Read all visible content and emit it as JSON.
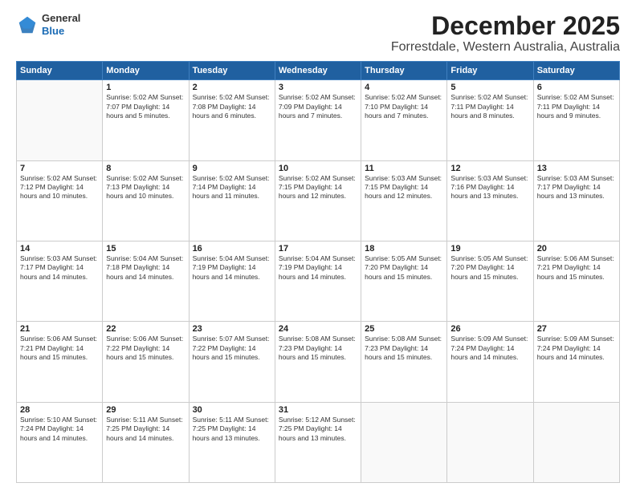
{
  "header": {
    "logo_general": "General",
    "logo_blue": "Blue",
    "title": "December 2025",
    "subtitle": "Forrestdale, Western Australia, Australia"
  },
  "calendar": {
    "days_of_week": [
      "Sunday",
      "Monday",
      "Tuesday",
      "Wednesday",
      "Thursday",
      "Friday",
      "Saturday"
    ],
    "weeks": [
      [
        {
          "day": "",
          "info": ""
        },
        {
          "day": "1",
          "info": "Sunrise: 5:02 AM\nSunset: 7:07 PM\nDaylight: 14 hours\nand 5 minutes."
        },
        {
          "day": "2",
          "info": "Sunrise: 5:02 AM\nSunset: 7:08 PM\nDaylight: 14 hours\nand 6 minutes."
        },
        {
          "day": "3",
          "info": "Sunrise: 5:02 AM\nSunset: 7:09 PM\nDaylight: 14 hours\nand 7 minutes."
        },
        {
          "day": "4",
          "info": "Sunrise: 5:02 AM\nSunset: 7:10 PM\nDaylight: 14 hours\nand 7 minutes."
        },
        {
          "day": "5",
          "info": "Sunrise: 5:02 AM\nSunset: 7:11 PM\nDaylight: 14 hours\nand 8 minutes."
        },
        {
          "day": "6",
          "info": "Sunrise: 5:02 AM\nSunset: 7:11 PM\nDaylight: 14 hours\nand 9 minutes."
        }
      ],
      [
        {
          "day": "7",
          "info": "Sunrise: 5:02 AM\nSunset: 7:12 PM\nDaylight: 14 hours\nand 10 minutes."
        },
        {
          "day": "8",
          "info": "Sunrise: 5:02 AM\nSunset: 7:13 PM\nDaylight: 14 hours\nand 10 minutes."
        },
        {
          "day": "9",
          "info": "Sunrise: 5:02 AM\nSunset: 7:14 PM\nDaylight: 14 hours\nand 11 minutes."
        },
        {
          "day": "10",
          "info": "Sunrise: 5:02 AM\nSunset: 7:15 PM\nDaylight: 14 hours\nand 12 minutes."
        },
        {
          "day": "11",
          "info": "Sunrise: 5:03 AM\nSunset: 7:15 PM\nDaylight: 14 hours\nand 12 minutes."
        },
        {
          "day": "12",
          "info": "Sunrise: 5:03 AM\nSunset: 7:16 PM\nDaylight: 14 hours\nand 13 minutes."
        },
        {
          "day": "13",
          "info": "Sunrise: 5:03 AM\nSunset: 7:17 PM\nDaylight: 14 hours\nand 13 minutes."
        }
      ],
      [
        {
          "day": "14",
          "info": "Sunrise: 5:03 AM\nSunset: 7:17 PM\nDaylight: 14 hours\nand 14 minutes."
        },
        {
          "day": "15",
          "info": "Sunrise: 5:04 AM\nSunset: 7:18 PM\nDaylight: 14 hours\nand 14 minutes."
        },
        {
          "day": "16",
          "info": "Sunrise: 5:04 AM\nSunset: 7:19 PM\nDaylight: 14 hours\nand 14 minutes."
        },
        {
          "day": "17",
          "info": "Sunrise: 5:04 AM\nSunset: 7:19 PM\nDaylight: 14 hours\nand 14 minutes."
        },
        {
          "day": "18",
          "info": "Sunrise: 5:05 AM\nSunset: 7:20 PM\nDaylight: 14 hours\nand 15 minutes."
        },
        {
          "day": "19",
          "info": "Sunrise: 5:05 AM\nSunset: 7:20 PM\nDaylight: 14 hours\nand 15 minutes."
        },
        {
          "day": "20",
          "info": "Sunrise: 5:06 AM\nSunset: 7:21 PM\nDaylight: 14 hours\nand 15 minutes."
        }
      ],
      [
        {
          "day": "21",
          "info": "Sunrise: 5:06 AM\nSunset: 7:21 PM\nDaylight: 14 hours\nand 15 minutes."
        },
        {
          "day": "22",
          "info": "Sunrise: 5:06 AM\nSunset: 7:22 PM\nDaylight: 14 hours\nand 15 minutes."
        },
        {
          "day": "23",
          "info": "Sunrise: 5:07 AM\nSunset: 7:22 PM\nDaylight: 14 hours\nand 15 minutes."
        },
        {
          "day": "24",
          "info": "Sunrise: 5:08 AM\nSunset: 7:23 PM\nDaylight: 14 hours\nand 15 minutes."
        },
        {
          "day": "25",
          "info": "Sunrise: 5:08 AM\nSunset: 7:23 PM\nDaylight: 14 hours\nand 15 minutes."
        },
        {
          "day": "26",
          "info": "Sunrise: 5:09 AM\nSunset: 7:24 PM\nDaylight: 14 hours\nand 14 minutes."
        },
        {
          "day": "27",
          "info": "Sunrise: 5:09 AM\nSunset: 7:24 PM\nDaylight: 14 hours\nand 14 minutes."
        }
      ],
      [
        {
          "day": "28",
          "info": "Sunrise: 5:10 AM\nSunset: 7:24 PM\nDaylight: 14 hours\nand 14 minutes."
        },
        {
          "day": "29",
          "info": "Sunrise: 5:11 AM\nSunset: 7:25 PM\nDaylight: 14 hours\nand 14 minutes."
        },
        {
          "day": "30",
          "info": "Sunrise: 5:11 AM\nSunset: 7:25 PM\nDaylight: 14 hours\nand 13 minutes."
        },
        {
          "day": "31",
          "info": "Sunrise: 5:12 AM\nSunset: 7:25 PM\nDaylight: 14 hours\nand 13 minutes."
        },
        {
          "day": "",
          "info": ""
        },
        {
          "day": "",
          "info": ""
        },
        {
          "day": "",
          "info": ""
        }
      ]
    ]
  }
}
